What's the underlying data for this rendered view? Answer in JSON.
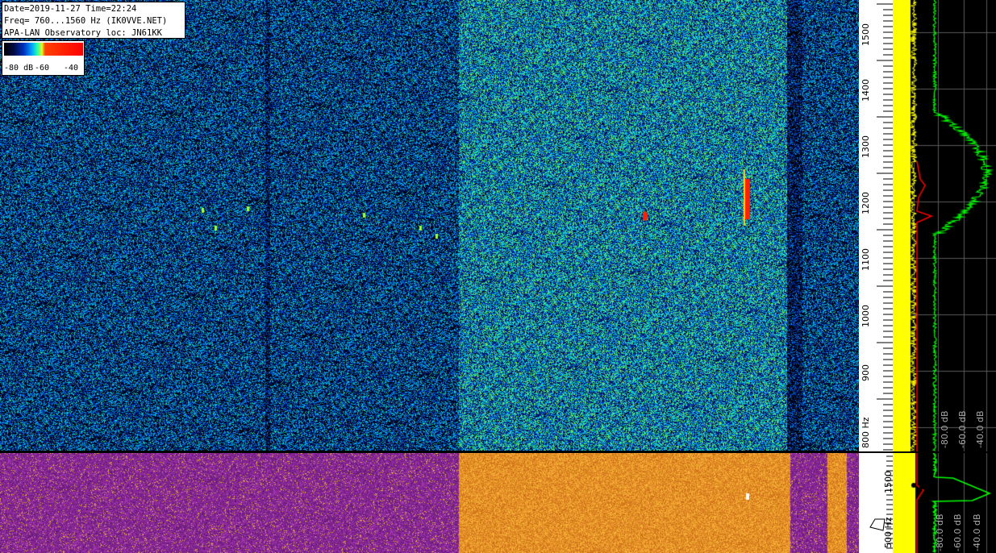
{
  "info": {
    "line1": "Date=2019-11-27 Time=22:24",
    "line2": "Freq= 760...1560 Hz (IK0VVE.NET)",
    "line3": "APA-LAN Observatory loc: JN61KK"
  },
  "scale": {
    "low": "-80 dB",
    "mid": "-60",
    "high": "-40"
  },
  "freq_axis": {
    "labels": [
      "1500",
      "1400",
      "1300",
      "1200",
      "1100",
      "1000",
      "900",
      "800 Hz"
    ]
  },
  "freq_axis_sub": {
    "labels": [
      "1500",
      "500 Hz"
    ]
  },
  "spectrum_axis": {
    "labels": [
      "-80.0 dB",
      "-60.0 dB",
      "-40.0 dB"
    ]
  },
  "spectrum_axis_sub": {
    "labels": [
      "-80.0 dB",
      "-60.0 dB",
      "-40.0 dB"
    ]
  },
  "colors": {
    "avg_trace": "#ffff00",
    "peak_trace": "#00ff00",
    "marker_trace": "#ff0000",
    "grid": "#5a5a5a"
  }
}
